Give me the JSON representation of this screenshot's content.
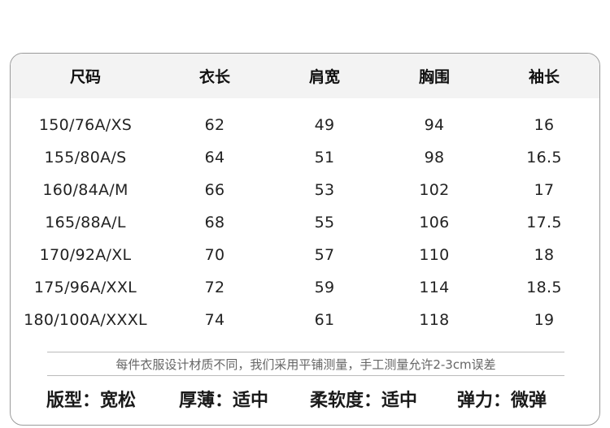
{
  "table": {
    "headers": [
      "尺码",
      "衣长",
      "肩宽",
      "胸围",
      "袖长"
    ],
    "rows": [
      [
        "150/76A/XS",
        "62",
        "49",
        "94",
        "16"
      ],
      [
        "155/80A/S",
        "64",
        "51",
        "98",
        "16.5"
      ],
      [
        "160/84A/M",
        "66",
        "53",
        "102",
        "17"
      ],
      [
        "165/88A/L",
        "68",
        "55",
        "106",
        "17.5"
      ],
      [
        "170/92A/XL",
        "70",
        "57",
        "110",
        "18"
      ],
      [
        "175/96A/XXL",
        "72",
        "59",
        "114",
        "18.5"
      ],
      [
        "180/100A/XXXL",
        "74",
        "61",
        "118",
        "19"
      ]
    ]
  },
  "note": "每件衣服设计材质不同，我们采用平铺测量，手工测量允许2-3cm误差",
  "properties": [
    "版型：宽松",
    "厚薄：适中",
    "柔软度：适中",
    "弹力：微弹"
  ]
}
